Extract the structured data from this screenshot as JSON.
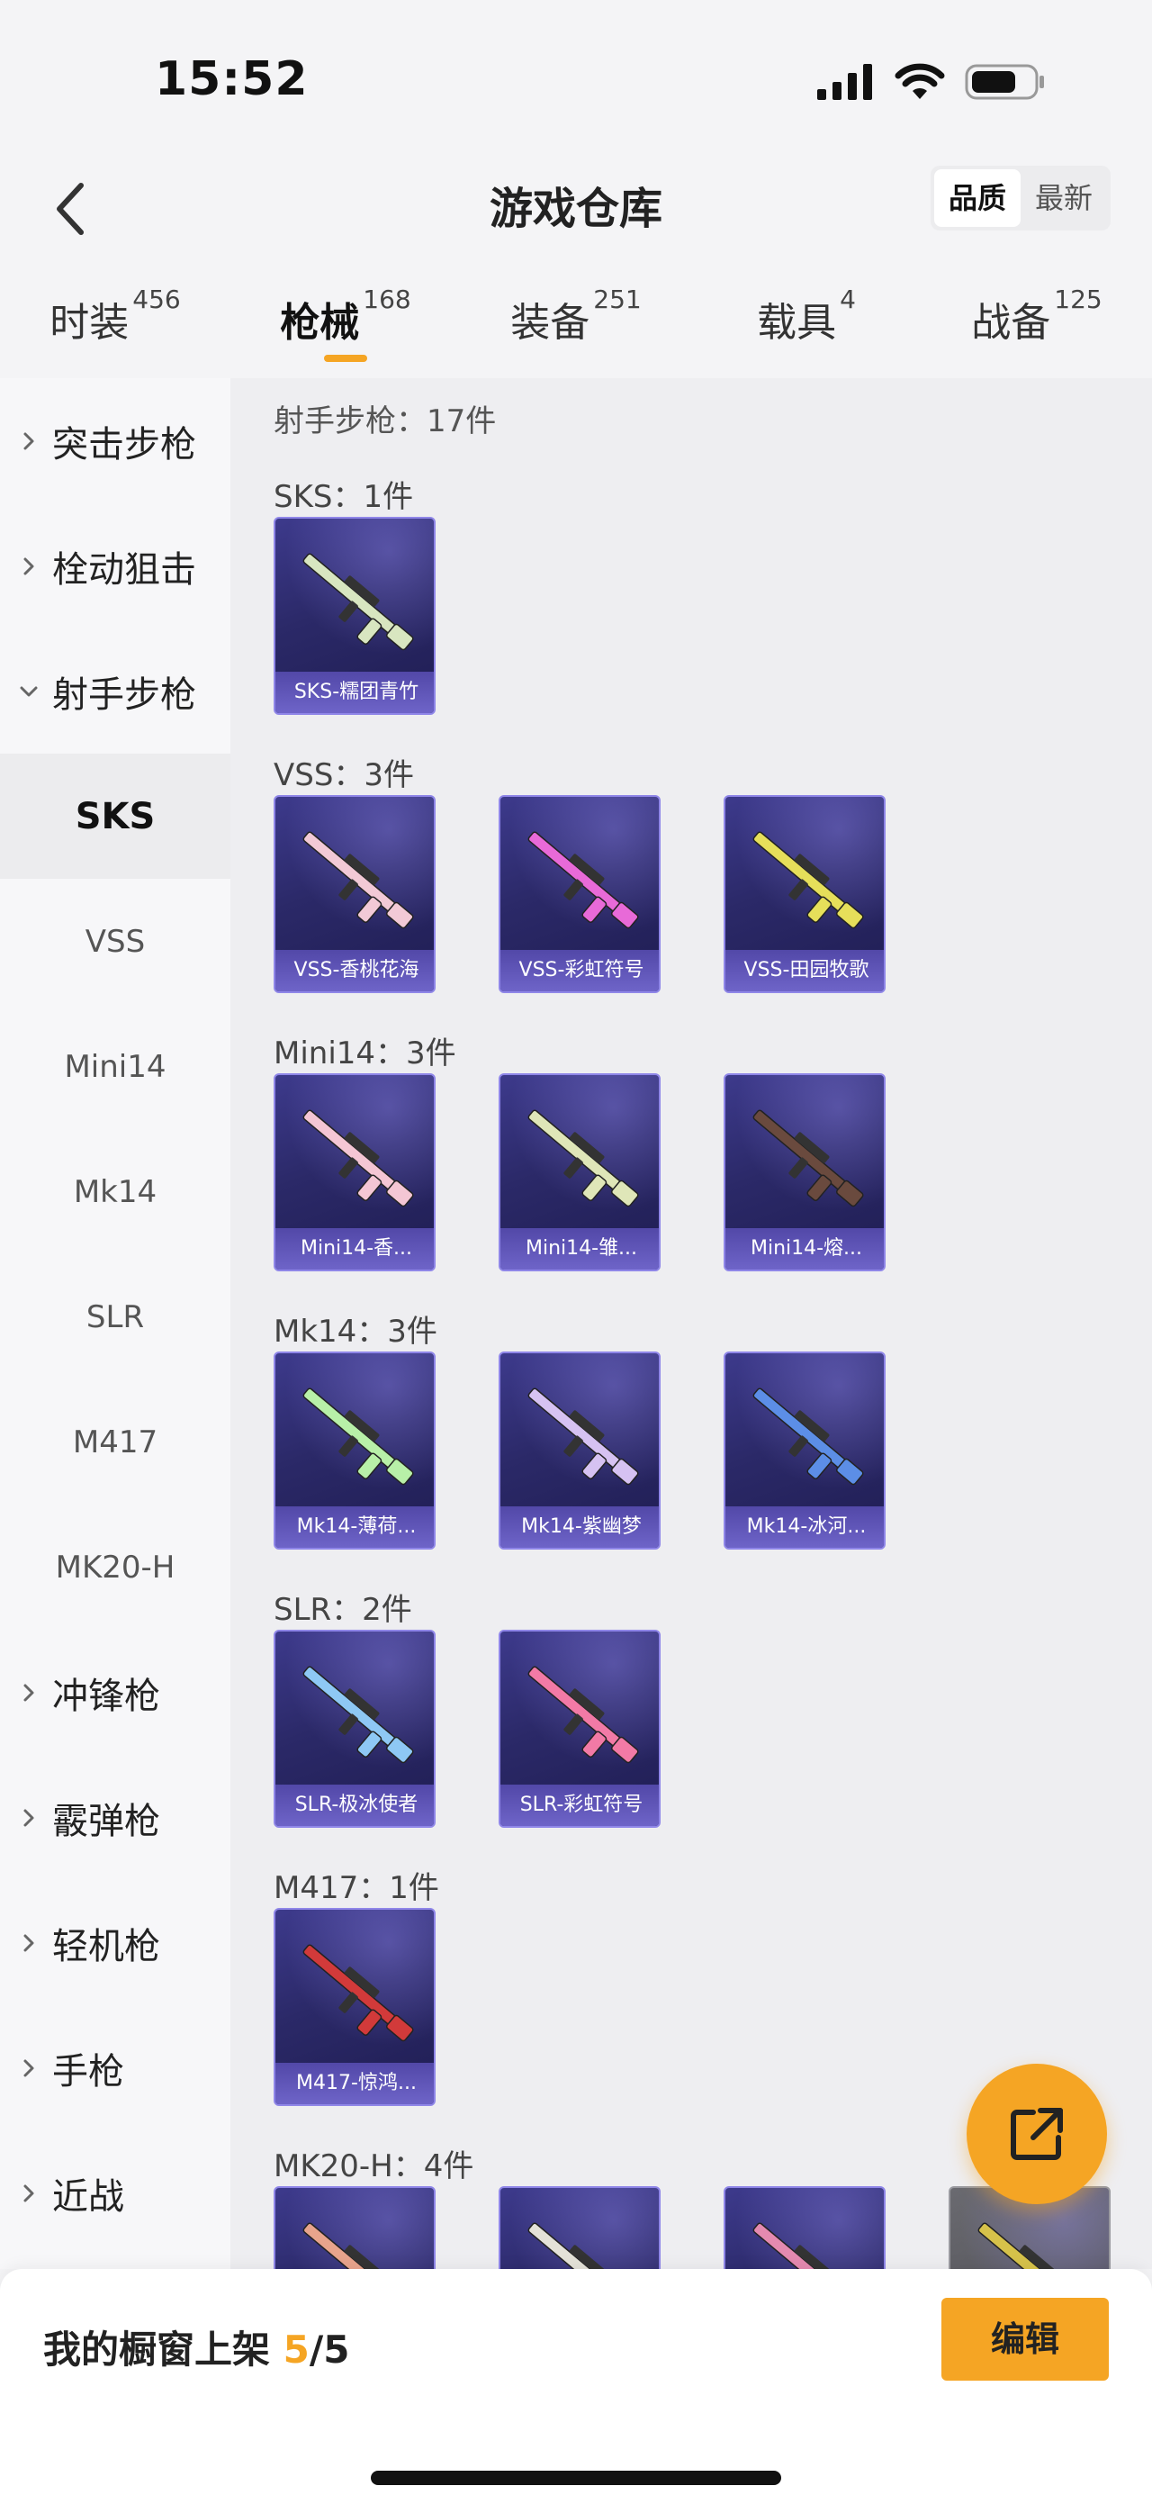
{
  "status_bar": {
    "time": "15:52"
  },
  "header": {
    "title": "游戏仓库",
    "sort_options": [
      "品质",
      "最新"
    ],
    "sort_active": "品质"
  },
  "tabs": [
    {
      "label": "时装",
      "count": "456"
    },
    {
      "label": "枪械",
      "count": "168",
      "active": true
    },
    {
      "label": "装备",
      "count": "251"
    },
    {
      "label": "载具",
      "count": "4"
    },
    {
      "label": "战备",
      "count": "125"
    }
  ],
  "sidebar": [
    {
      "label": "突击步枪",
      "type": "category"
    },
    {
      "label": "栓动狙击",
      "type": "category"
    },
    {
      "label": "射手步枪",
      "type": "category",
      "expanded": true
    },
    {
      "label": "SKS",
      "type": "sub",
      "active": true
    },
    {
      "label": "VSS",
      "type": "sub"
    },
    {
      "label": "Mini14",
      "type": "sub"
    },
    {
      "label": "Mk14",
      "type": "sub"
    },
    {
      "label": "SLR",
      "type": "sub"
    },
    {
      "label": "M417",
      "type": "sub"
    },
    {
      "label": "MK20-H",
      "type": "sub"
    },
    {
      "label": "冲锋枪",
      "type": "category"
    },
    {
      "label": "霰弹枪",
      "type": "category"
    },
    {
      "label": "轻机枪",
      "type": "category"
    },
    {
      "label": "手枪",
      "type": "category"
    },
    {
      "label": "近战",
      "type": "category"
    }
  ],
  "content": {
    "total": "射手步枪：17件",
    "groups": [
      {
        "label": "SKS：1件",
        "items": [
          {
            "name": "SKS-糯团青竹",
            "color": "#d8e6c0"
          }
        ]
      },
      {
        "label": "VSS：3件",
        "items": [
          {
            "name": "VSS-香桃花海",
            "color": "#f2c9d6"
          },
          {
            "name": "VSS-彩虹符号",
            "color": "#e86ad8"
          },
          {
            "name": "VSS-田园牧歌",
            "color": "#e6df5a"
          }
        ]
      },
      {
        "label": "Mini14：3件",
        "items": [
          {
            "name": "Mini14-香...",
            "color": "#f4c6d4"
          },
          {
            "name": "Mini14-雏...",
            "color": "#dfe6b8"
          },
          {
            "name": "Mini14-熔...",
            "color": "#6a4a3e"
          }
        ]
      },
      {
        "label": "Mk14：3件",
        "items": [
          {
            "name": "Mk14-薄荷...",
            "color": "#b8f0a8"
          },
          {
            "name": "Mk14-紫幽梦",
            "color": "#d6c2f2"
          },
          {
            "name": "Mk14-冰河...",
            "color": "#5c8ee6"
          }
        ]
      },
      {
        "label": "SLR：2件",
        "items": [
          {
            "name": "SLR-极冰使者",
            "color": "#8ec8f4"
          },
          {
            "name": "SLR-彩虹符号",
            "color": "#f27aa6"
          }
        ]
      },
      {
        "label": "M417：1件",
        "items": [
          {
            "name": "M417-惊鸿...",
            "color": "#d23a3a"
          }
        ]
      },
      {
        "label": "MK20-H：4件",
        "items": [
          {
            "name": "",
            "color": "#e8a48c"
          },
          {
            "name": "",
            "color": "#e4e2d8"
          },
          {
            "name": "",
            "color": "#e48ab0"
          },
          {
            "name": "",
            "color": "#d6c24a",
            "gray": true
          }
        ]
      }
    ]
  },
  "bottom_bar": {
    "label_prefix": "我的橱窗上架 ",
    "current": "5",
    "total": "/5",
    "edit_label": "编辑"
  },
  "colors": {
    "accent": "#f5a524",
    "card_bg": "#2b2968",
    "card_border": "#8f86e8"
  },
  "icons": [
    "signal-icon",
    "wifi-icon",
    "battery-icon",
    "back-arrow-icon",
    "chevron-right-icon",
    "chevron-down-icon",
    "share-icon"
  ]
}
